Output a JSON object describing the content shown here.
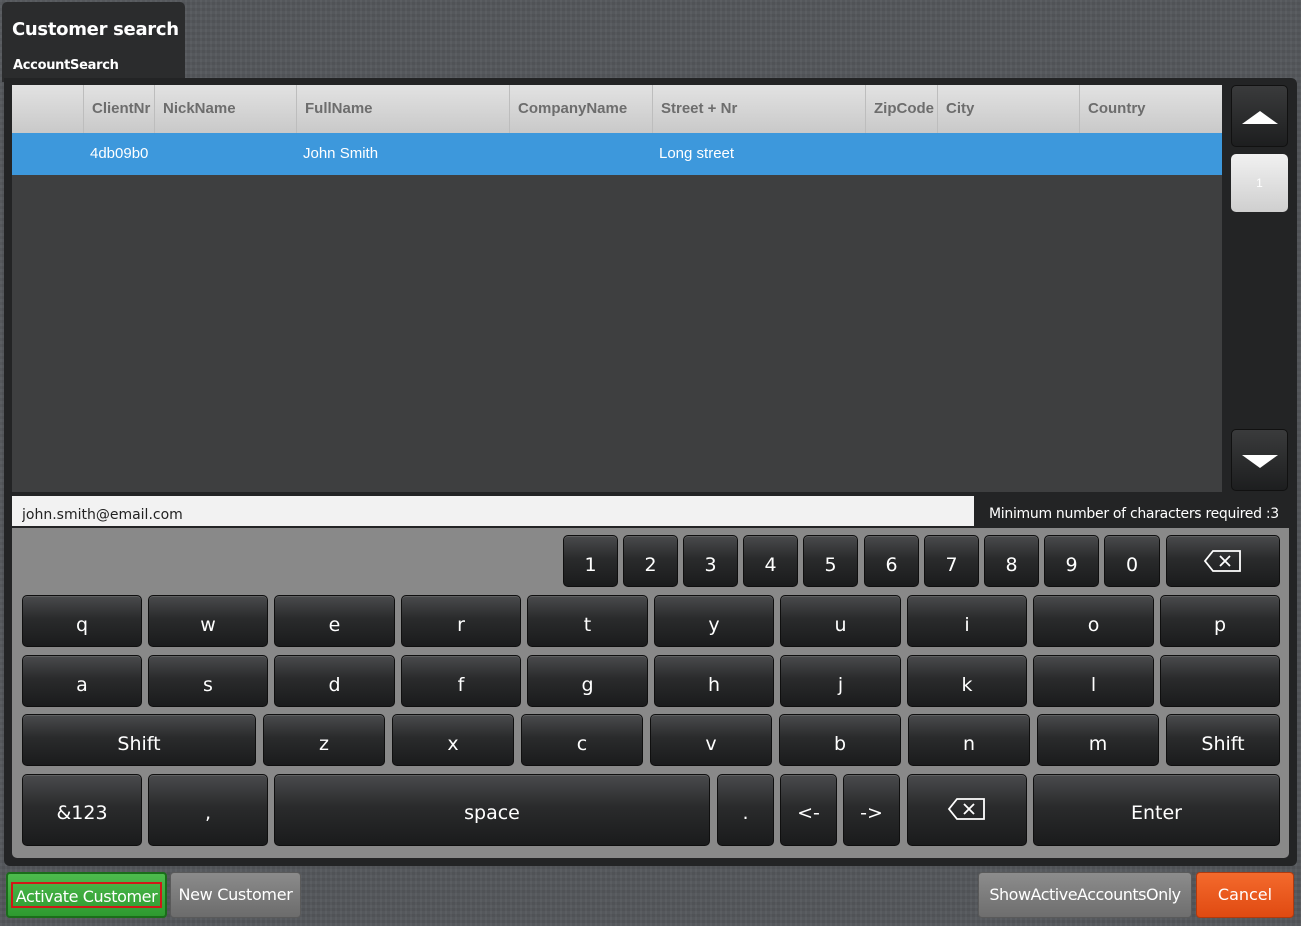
{
  "header": {
    "title": "Customer search",
    "subtitle": "AccountSearch"
  },
  "grid": {
    "columns": [
      "",
      "ClientNr",
      "NickName",
      "FullName",
      "CompanyName",
      "Street + Nr",
      "ZipCode",
      "City",
      "Country"
    ],
    "rows": [
      {
        "selected": true,
        "cells": [
          "",
          "4db09b0",
          "",
          "John Smith",
          "",
          "Long street",
          "",
          "",
          ""
        ]
      }
    ]
  },
  "pager": {
    "current_page": "1",
    "up_icon": "triangle-up-icon",
    "down_icon": "triangle-down-icon"
  },
  "search": {
    "value": "john.smith@email.com",
    "min_chars_note": "Minimum number of characters required :3"
  },
  "keyboard": {
    "numbers": [
      "1",
      "2",
      "3",
      "4",
      "5",
      "6",
      "7",
      "8",
      "9",
      "0"
    ],
    "row_q": [
      "q",
      "w",
      "e",
      "r",
      "t",
      "y",
      "u",
      "i",
      "o",
      "p"
    ],
    "row_a": [
      "a",
      "s",
      "d",
      "f",
      "g",
      "h",
      "j",
      "k",
      "l",
      ""
    ],
    "row_z": [
      "z",
      "x",
      "c",
      "v",
      "b",
      "n",
      "m"
    ],
    "shift": "Shift",
    "sym": "&123",
    "comma": ",",
    "space": "space",
    "period": ".",
    "left": "<-",
    "right": "->",
    "enter": "Enter",
    "backspace_icon": "backspace-icon"
  },
  "buttons": {
    "activate": "Activate Customer",
    "new": "New Customer",
    "show_active": "ShowActiveAccountsOnly",
    "cancel": "Cancel"
  },
  "colors": {
    "selected_row": "#3d98dc",
    "activate": "#3aaa3c",
    "cancel": "#ea5a1c",
    "keyboard_bg": "#898989"
  }
}
